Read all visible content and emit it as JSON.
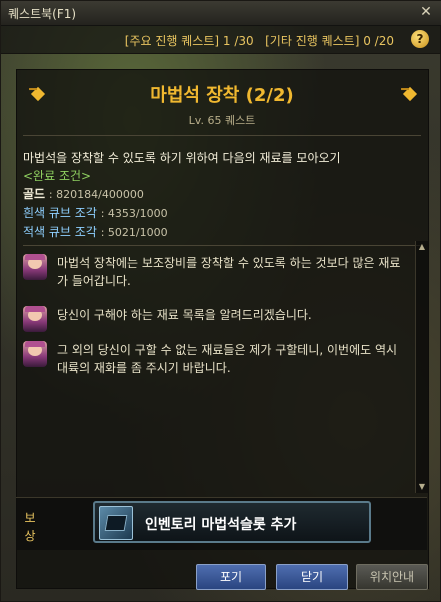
{
  "window": {
    "title": "퀘스트북(F1)"
  },
  "counts": {
    "main_label": "[주요 진행 퀘스트]",
    "main_value": "1 /30",
    "other_label": "[기타 진행 퀘스트]",
    "other_value": "0 /20"
  },
  "quest": {
    "title": "마법석 장착 (2/2)",
    "subtitle": "Lv. 65 퀘스트",
    "description": "마법석을 장착할 수 있도록 하기 위하여 다음의 재료를 모아오기",
    "condition": "<완료 조건>",
    "requirements": [
      {
        "name": "골드",
        "value": "820184/400000"
      },
      {
        "name": "흰색 큐브 조각",
        "value": "4353/1000"
      },
      {
        "name": "적색 큐브 조각",
        "value": "5021/1000"
      }
    ]
  },
  "dialogue": [
    {
      "text": "마법석 장착에는 보조장비를 장착할 수 있도록 하는 것보다 많은 재료가 들어갑니다."
    },
    {
      "text": "당신이 구해야 하는 재료 목록을 알려드리겠습니다."
    },
    {
      "text": "그 외의 당신이 구할 수 없는 재료들은 제가 구할테니, 이번에도 역시 대륙의 재화를 좀 주시기 바랍니다."
    }
  ],
  "reward": {
    "label": "보상",
    "item": "인벤토리 마법석슬롯 추가"
  },
  "buttons": {
    "abandon": "포기",
    "close": "닫기",
    "location": "위치안내"
  },
  "colors": {
    "accent": "#f0b830",
    "condition": "#8fd060",
    "subitem": "#8fd0ff"
  }
}
